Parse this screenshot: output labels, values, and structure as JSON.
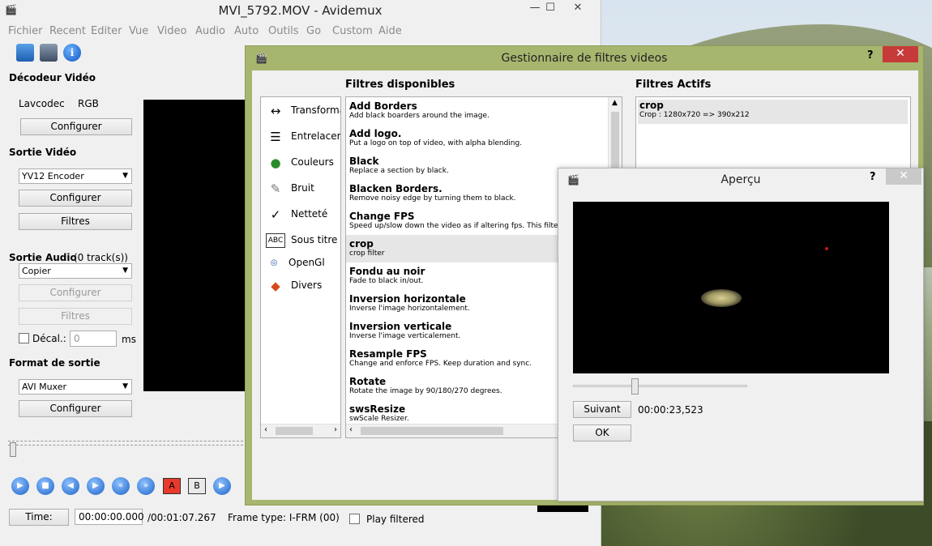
{
  "main_window": {
    "title": "MVI_5792.MOV - Avidemux",
    "minimize": "—",
    "maximize": "☐",
    "close": "✕"
  },
  "menu": [
    "Fichier",
    "Recent",
    "Editer",
    "Vue",
    "Video",
    "Audio",
    "Auto",
    "Outils",
    "Go",
    "Custom",
    "Aide"
  ],
  "video_decoder": {
    "heading": "Décodeur Vidéo",
    "codec": "Lavcodec",
    "format": "RGB",
    "configure": "Configurer"
  },
  "video_output": {
    "heading": "Sortie Vidéo",
    "encoder": "YV12 Encoder",
    "configure": "Configurer",
    "filters": "Filtres"
  },
  "audio_output": {
    "heading": "Sortie Audio",
    "tracks": "(0 track(s))",
    "encoder": "Copier",
    "configure": "Configurer",
    "filters": "Filtres",
    "shift_label": "Décal.:",
    "shift_value": "0",
    "shift_unit": "ms"
  },
  "output_format": {
    "heading": "Format de sortie",
    "muxer": "AVI Muxer",
    "configure": "Configurer"
  },
  "status": {
    "time_button": "Time:",
    "current_time": "00:00:00.000",
    "total_time": "/00:01:07.267",
    "frame_type": "Frame type:  I-FRM (00)",
    "play_filtered": "Play filtered"
  },
  "playback_controls": [
    "play",
    "stop",
    "prev-frame",
    "next-frame",
    "prev-keyframe",
    "next-keyframe"
  ],
  "marker_a": "A",
  "marker_b": "B",
  "filter_manager": {
    "title": "Gestionnaire de filtres videos",
    "help": "?",
    "close": "✕",
    "available_heading": "Filtres disponibles",
    "active_heading": "Filtres Actifs",
    "categories": [
      {
        "icon": "transform-icon",
        "label": "Transforma"
      },
      {
        "icon": "interlace-icon",
        "label": "Entrelacem"
      },
      {
        "icon": "colors-icon",
        "label": "Couleurs"
      },
      {
        "icon": "noise-icon",
        "label": "Bruit"
      },
      {
        "icon": "sharpness-icon",
        "label": "Netteté"
      },
      {
        "icon": "subtitle-icon",
        "label": "Sous titre"
      },
      {
        "icon": "opengl-icon",
        "label": "OpenGl"
      },
      {
        "icon": "misc-icon",
        "label": "Divers"
      }
    ],
    "available": [
      {
        "name": "Add Borders",
        "desc": "Add black boarders around the image."
      },
      {
        "name": "Add logo.",
        "desc": "Put a logo on top of video, with alpha blending."
      },
      {
        "name": "Black",
        "desc": "Replace a section by black."
      },
      {
        "name": "Blacken Borders.",
        "desc": "Remove noisy edge by turning them to black."
      },
      {
        "name": "Change FPS",
        "desc": "Speed up/slow down the video as if altering fps. This filter c"
      },
      {
        "name": "crop",
        "desc": "crop filter"
      },
      {
        "name": "Fondu au noir",
        "desc": "Fade to black in/out."
      },
      {
        "name": "Inversion horizontale",
        "desc": "Inverse l'image horizontalement."
      },
      {
        "name": "Inversion verticale",
        "desc": "Inverse l'image verticalement."
      },
      {
        "name": "Resample FPS",
        "desc": "Change and enforce FPS. Keep duration and sync."
      },
      {
        "name": "Rotate",
        "desc": "Rotate the image by 90/180/270 degrees."
      },
      {
        "name": "swsResize",
        "desc": "swScale Resizer."
      }
    ],
    "selected_available": "crop",
    "active": [
      {
        "name": "crop",
        "desc": "Crop : 1280x720 => 390x212"
      }
    ]
  },
  "preview": {
    "title": "Aperçu",
    "help": "?",
    "close": "✕",
    "next_button": "Suivant",
    "timestamp": "00:00:23,523",
    "ok_button": "OK"
  }
}
